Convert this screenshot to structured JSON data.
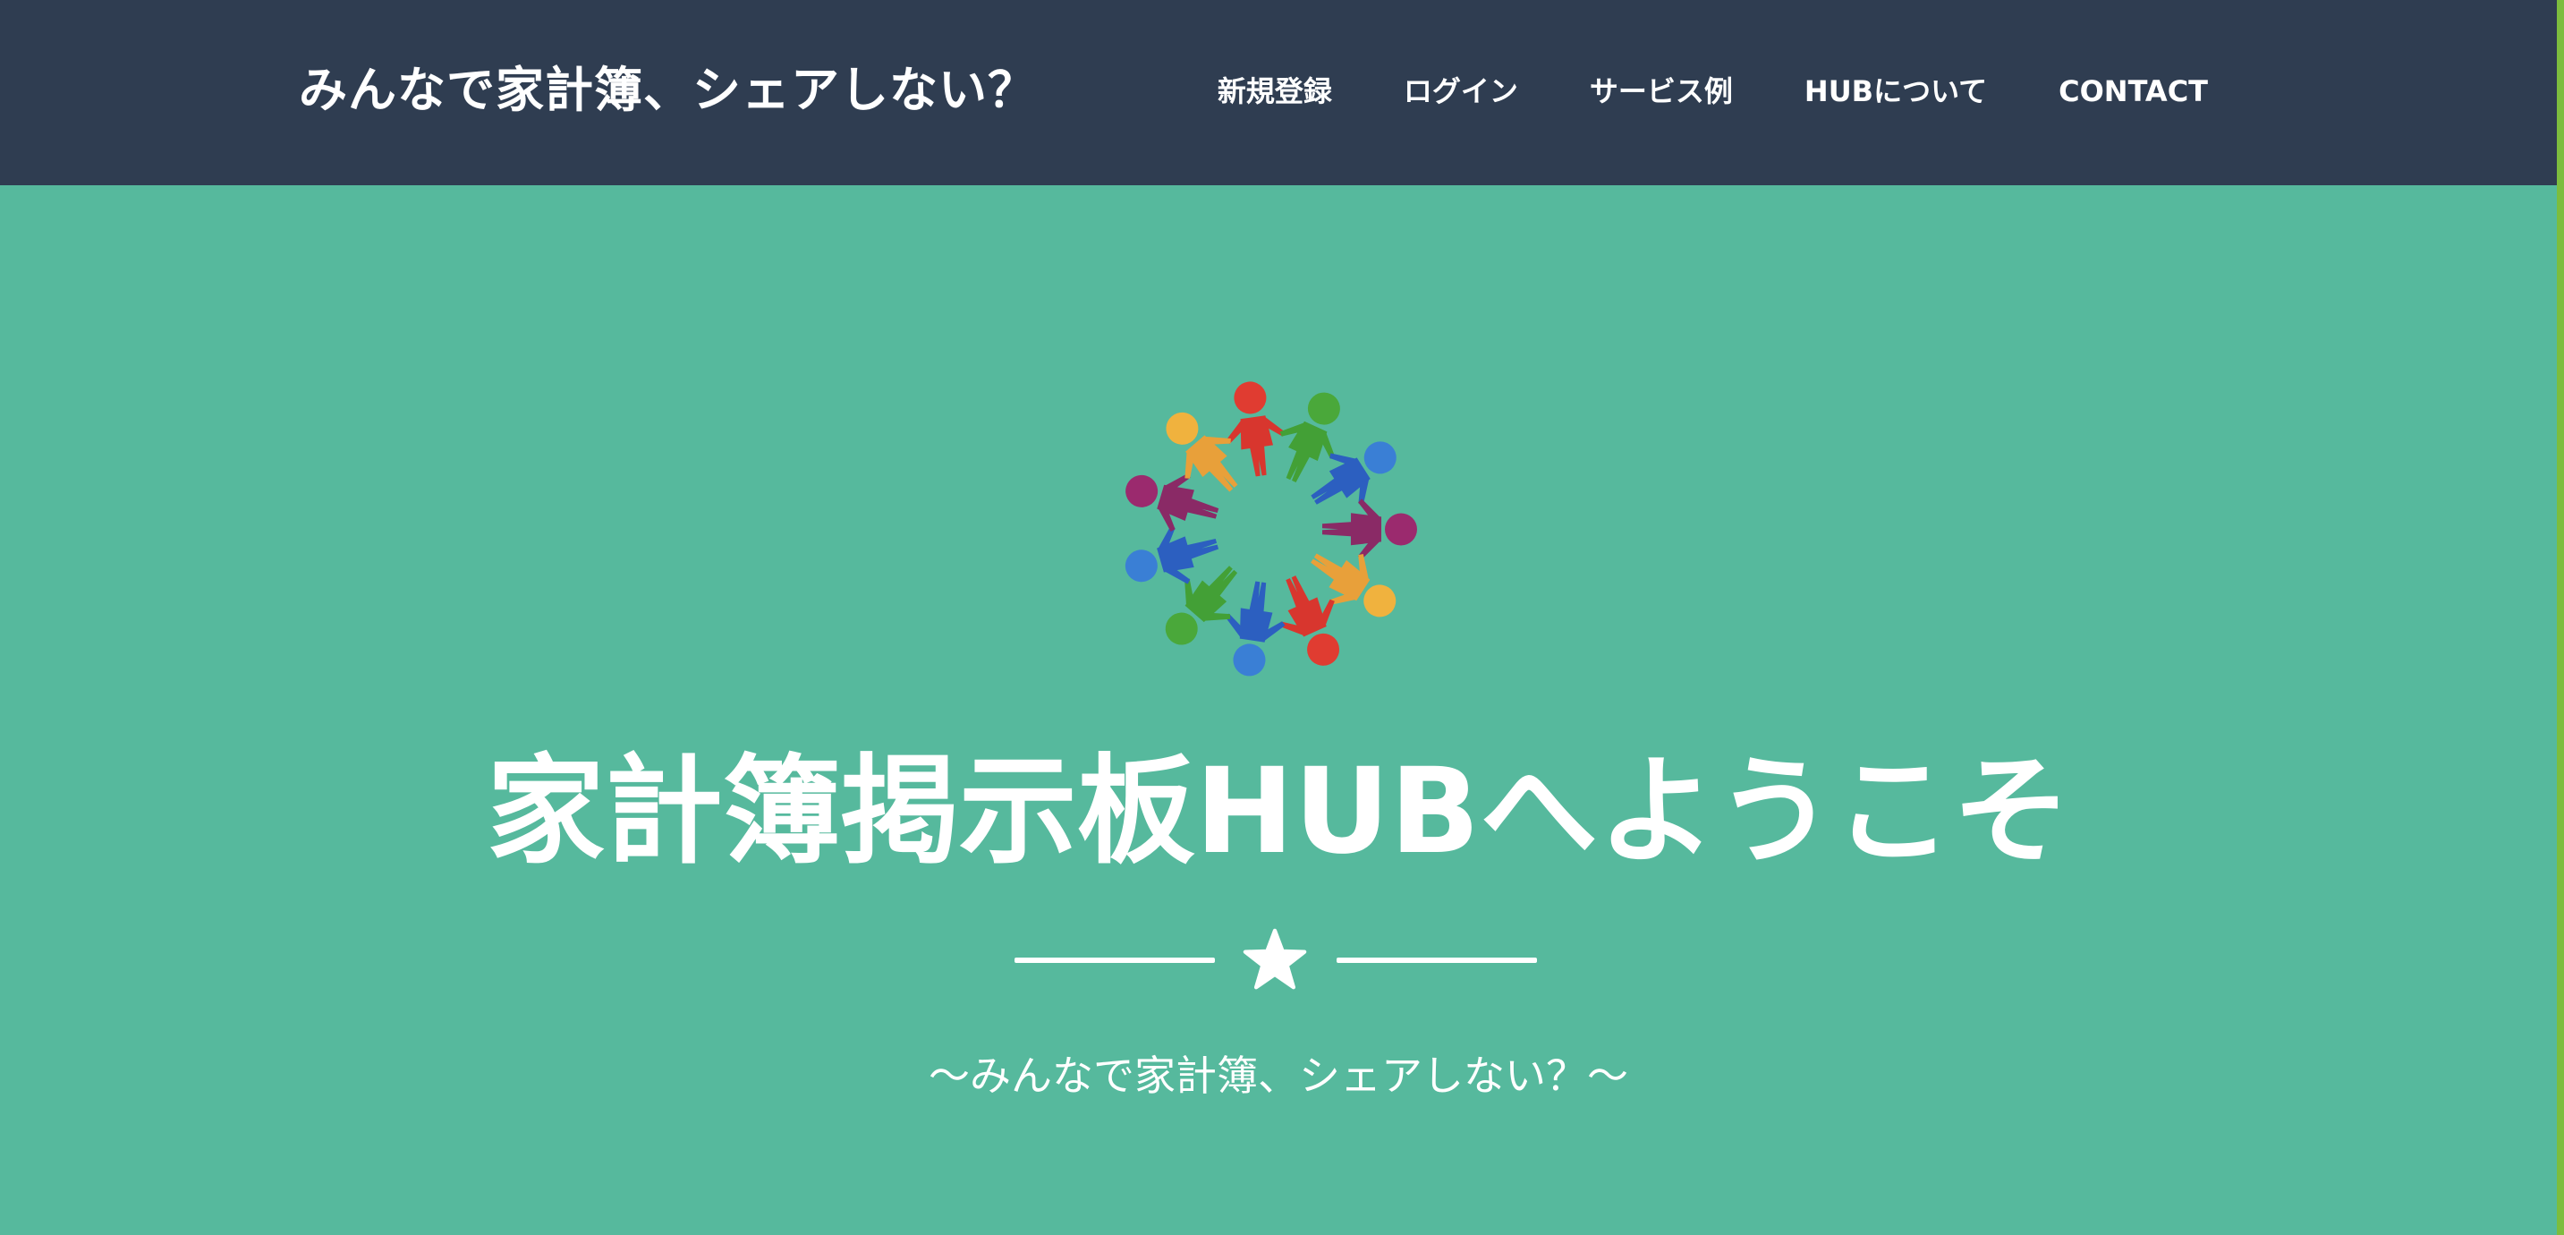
{
  "navbar": {
    "brand": "みんなで家計簿、シェアしない？",
    "links": [
      {
        "label": "新規登録"
      },
      {
        "label": "ログイン"
      },
      {
        "label": "サービス例"
      },
      {
        "label": "HUBについて"
      },
      {
        "label": "CONTACT"
      }
    ]
  },
  "hero": {
    "logo_icon": "people-circle-logo-icon",
    "title": "家計簿掲示板HUBへようこそ",
    "divider_icon": "star-icon",
    "subtitle": "〜みんなで家計簿、シェアしない？〜"
  },
  "colors": {
    "navbar_bg": "#2f3d51",
    "hero_bg": "#56b99d",
    "text": "#ffffff",
    "edge_accent": "#7dbd3e"
  }
}
